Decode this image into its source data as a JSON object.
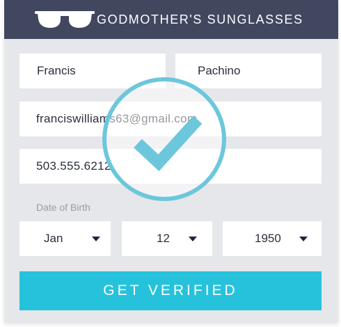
{
  "header": {
    "brand": "GODMOTHER'S SUNGLASSES",
    "logo_icon": "sunglasses-icon",
    "background": "#41475e"
  },
  "form": {
    "first_name": "Francis",
    "last_name": "Pachino",
    "email": "franciswilliams63@gmail.com",
    "phone": "503.555.6212",
    "dob_label": "Date of Birth",
    "dob": {
      "month": "Jan",
      "day": "12",
      "year": "1950"
    },
    "submit_label": "GET VERIFIED"
  },
  "overlay": {
    "icon": "checkmark-circle-icon",
    "color": "#6cc7dc"
  },
  "colors": {
    "accent": "#26c2dc",
    "card_bg": "#e6e7ea",
    "text": "#2b2f3a"
  }
}
